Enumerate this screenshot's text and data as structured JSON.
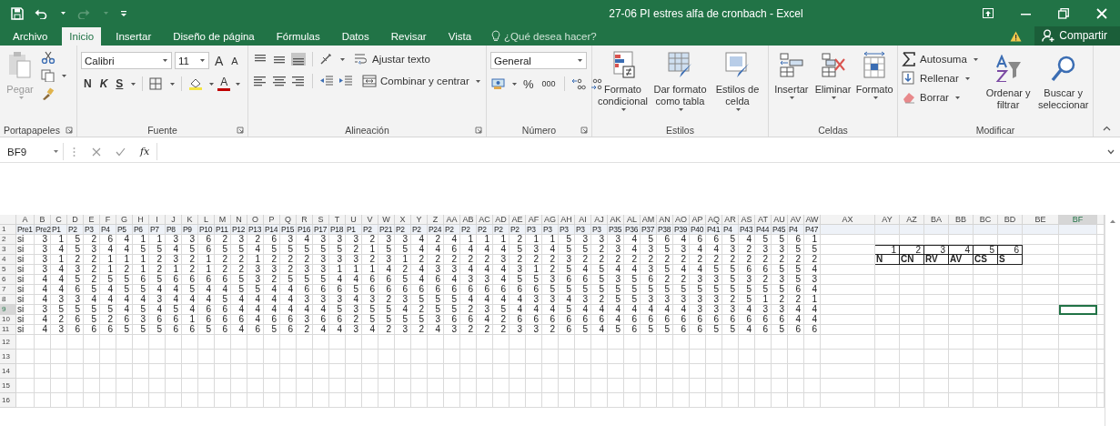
{
  "window": {
    "title": "27-06 PI estres alfa de cronbach - Excel"
  },
  "tabs": [
    {
      "label": "Archivo",
      "selected": false
    },
    {
      "label": "Inicio",
      "selected": true
    },
    {
      "label": "Insertar",
      "selected": false
    },
    {
      "label": "Diseño de página",
      "selected": false
    },
    {
      "label": "Fórmulas",
      "selected": false
    },
    {
      "label": "Datos",
      "selected": false
    },
    {
      "label": "Revisar",
      "selected": false
    },
    {
      "label": "Vista",
      "selected": false
    }
  ],
  "tell_me": {
    "placeholder": "¿Qué desea hacer?"
  },
  "share_button": "Compartir",
  "ribbon": [
    {
      "kind": "clipboard",
      "label": "Portapapeles",
      "paste": {
        "label": "Pegar",
        "disabled": true
      }
    },
    {
      "kind": "font",
      "label": "Fuente",
      "font": "Calibri",
      "size": "11",
      "grow": "A",
      "shrink": "A",
      "bold": "N",
      "italic": "K",
      "underline": "S",
      "font_color": "A"
    },
    {
      "kind": "alignment",
      "label": "Alineación",
      "wrap": "Ajustar texto",
      "merge": "Combinar y centrar"
    },
    {
      "kind": "number",
      "label": "Número",
      "format": "General",
      "percent": "%",
      "thousands": "000"
    },
    {
      "kind": "styles",
      "label": "Estilos",
      "buttons": [
        "Formato condicional",
        "Dar formato como tabla",
        "Estilos de celda"
      ]
    },
    {
      "kind": "cells",
      "label": "Celdas",
      "buttons": [
        "Insertar",
        "Eliminar",
        "Formato"
      ]
    },
    {
      "kind": "editing",
      "label": "Modificar",
      "small": [
        "Autosuma",
        "Rellenar",
        "Borrar"
      ],
      "large": [
        "Ordenar y filtrar",
        "Buscar y seleccionar"
      ]
    }
  ],
  "formula_bar": {
    "name_box": "BF9",
    "function_label": "fx"
  },
  "sheet": {
    "column_headers": [
      "A",
      "B",
      "C",
      "D",
      "E",
      "F",
      "G",
      "H",
      "I",
      "J",
      "K",
      "L",
      "M",
      "N",
      "O",
      "P",
      "Q",
      "R",
      "S",
      "T",
      "U",
      "V",
      "W",
      "X",
      "Y",
      "Z",
      "AA",
      "AB",
      "AC",
      "AD",
      "AE",
      "AF",
      "AG",
      "AH",
      "AI",
      "AJ",
      "AK",
      "AL",
      "AM",
      "AN",
      "AO",
      "AP",
      "AQ",
      "AR",
      "AS",
      "AT",
      "AU",
      "AV",
      "AW",
      "AX",
      "AY",
      "AZ",
      "BA",
      "BB",
      "BC",
      "BD",
      "BE",
      "BF"
    ],
    "row_numbers": [
      "1",
      "2",
      "3",
      "4",
      "5",
      "6",
      "7",
      "8",
      "9",
      "10",
      "11",
      "12",
      "13",
      "14",
      "15",
      "16"
    ],
    "rows": [
      [
        "Pre1",
        "Pre2",
        "P1",
        "P2",
        "P3",
        "P4",
        "P5",
        "P6",
        "P7",
        "P8",
        "P9",
        "P10",
        "P11",
        "P12",
        "P13",
        "P14",
        "P15",
        "P16",
        "P17",
        "P18",
        "P1",
        "P2",
        "P21",
        "P2",
        "P2",
        "P24",
        "P2",
        "P2",
        "P2",
        "P2",
        "P2",
        "P3",
        "P3",
        "P3",
        "P3",
        "P3",
        "P35",
        "P36",
        "P37",
        "P38",
        "P39",
        "P40",
        "P41",
        "P4",
        "P43",
        "P44",
        "P45",
        "P4",
        "P47"
      ],
      [
        "si",
        "3",
        "1",
        "5",
        "2",
        "6",
        "4",
        "1",
        "1",
        "3",
        "3",
        "6",
        "2",
        "3",
        "2",
        "6",
        "3",
        "4",
        "3",
        "3",
        "3",
        "2",
        "3",
        "3",
        "4",
        "2",
        "4",
        "1",
        "1",
        "1",
        "2",
        "1",
        "1",
        "5",
        "3",
        "3",
        "3",
        "4",
        "5",
        "6",
        "4",
        "6",
        "6",
        "5",
        "4",
        "5",
        "5",
        "6",
        "1"
      ],
      [
        "si",
        "3",
        "4",
        "5",
        "3",
        "4",
        "4",
        "5",
        "5",
        "4",
        "5",
        "6",
        "5",
        "5",
        "4",
        "5",
        "5",
        "5",
        "5",
        "5",
        "2",
        "1",
        "5",
        "5",
        "4",
        "4",
        "6",
        "4",
        "4",
        "4",
        "5",
        "3",
        "4",
        "5",
        "5",
        "2",
        "3",
        "4",
        "3",
        "5",
        "3",
        "4",
        "4",
        "3",
        "2",
        "3",
        "3",
        "5",
        "5"
      ],
      [
        "si",
        "3",
        "1",
        "2",
        "2",
        "1",
        "1",
        "1",
        "2",
        "3",
        "2",
        "1",
        "2",
        "2",
        "1",
        "2",
        "2",
        "2",
        "3",
        "3",
        "3",
        "2",
        "3",
        "1",
        "2",
        "2",
        "2",
        "2",
        "2",
        "3",
        "2",
        "2",
        "2",
        "3",
        "2",
        "2",
        "2",
        "2",
        "2",
        "2",
        "2",
        "2",
        "2",
        "2",
        "2",
        "2",
        "2",
        "2",
        "2"
      ],
      [
        "si",
        "3",
        "4",
        "3",
        "2",
        "1",
        "2",
        "1",
        "2",
        "1",
        "2",
        "1",
        "2",
        "2",
        "3",
        "3",
        "2",
        "3",
        "3",
        "1",
        "1",
        "1",
        "4",
        "2",
        "4",
        "3",
        "3",
        "4",
        "4",
        "4",
        "3",
        "1",
        "2",
        "5",
        "4",
        "5",
        "4",
        "4",
        "3",
        "5",
        "4",
        "4",
        "5",
        "5",
        "6",
        "6",
        "5",
        "5",
        "4"
      ],
      [
        "si",
        "4",
        "4",
        "5",
        "2",
        "5",
        "5",
        "6",
        "5",
        "6",
        "6",
        "6",
        "6",
        "5",
        "3",
        "2",
        "5",
        "5",
        "5",
        "4",
        "4",
        "6",
        "6",
        "5",
        "4",
        "6",
        "4",
        "3",
        "3",
        "4",
        "5",
        "5",
        "3",
        "6",
        "6",
        "5",
        "3",
        "5",
        "6",
        "2",
        "2",
        "3",
        "3",
        "5",
        "3",
        "2",
        "3",
        "5",
        "3"
      ],
      [
        "si",
        "4",
        "4",
        "6",
        "5",
        "4",
        "5",
        "5",
        "4",
        "4",
        "5",
        "4",
        "4",
        "5",
        "5",
        "4",
        "4",
        "6",
        "6",
        "6",
        "5",
        "6",
        "6",
        "6",
        "6",
        "6",
        "6",
        "6",
        "6",
        "6",
        "6",
        "6",
        "5",
        "5",
        "5",
        "5",
        "5",
        "5",
        "5",
        "5",
        "5",
        "5",
        "5",
        "5",
        "5",
        "5",
        "5",
        "6",
        "4"
      ],
      [
        "si",
        "4",
        "3",
        "3",
        "4",
        "4",
        "4",
        "4",
        "3",
        "4",
        "4",
        "4",
        "5",
        "4",
        "4",
        "4",
        "4",
        "3",
        "3",
        "3",
        "4",
        "3",
        "2",
        "3",
        "5",
        "5",
        "5",
        "4",
        "4",
        "4",
        "4",
        "3",
        "3",
        "4",
        "3",
        "2",
        "5",
        "5",
        "3",
        "3",
        "3",
        "3",
        "3",
        "2",
        "5",
        "1",
        "2",
        "2",
        "1"
      ],
      [
        "si",
        "3",
        "5",
        "5",
        "5",
        "5",
        "4",
        "5",
        "4",
        "5",
        "4",
        "6",
        "6",
        "4",
        "4",
        "4",
        "4",
        "4",
        "4",
        "5",
        "3",
        "5",
        "5",
        "4",
        "2",
        "5",
        "5",
        "2",
        "3",
        "5",
        "4",
        "4",
        "4",
        "5",
        "4",
        "4",
        "4",
        "4",
        "4",
        "4",
        "4",
        "3",
        "3",
        "3",
        "4",
        "3",
        "3",
        "4",
        "4"
      ],
      [
        "si",
        "4",
        "2",
        "6",
        "5",
        "2",
        "6",
        "3",
        "6",
        "6",
        "1",
        "6",
        "6",
        "6",
        "4",
        "6",
        "6",
        "3",
        "6",
        "6",
        "2",
        "5",
        "5",
        "5",
        "5",
        "3",
        "6",
        "6",
        "4",
        "2",
        "6",
        "6",
        "6",
        "6",
        "6",
        "6",
        "4",
        "6",
        "6",
        "6",
        "6",
        "6",
        "6",
        "6",
        "6",
        "6",
        "6",
        "4",
        "4"
      ],
      [
        "si",
        "4",
        "3",
        "6",
        "6",
        "6",
        "5",
        "5",
        "5",
        "6",
        "6",
        "5",
        "6",
        "4",
        "6",
        "5",
        "6",
        "2",
        "4",
        "4",
        "3",
        "4",
        "2",
        "3",
        "2",
        "4",
        "3",
        "2",
        "2",
        "2",
        "3",
        "3",
        "2",
        "6",
        "5",
        "4",
        "5",
        "6",
        "5",
        "5",
        "6",
        "6",
        "5",
        "5",
        "4",
        "6",
        "5",
        "6",
        "6"
      ]
    ],
    "scale_table": {
      "numbers": [
        "1",
        "2",
        "3",
        "4",
        "5",
        "6"
      ],
      "codes": [
        "N",
        "CN",
        "RV",
        "AV",
        "CS",
        "S"
      ]
    }
  }
}
